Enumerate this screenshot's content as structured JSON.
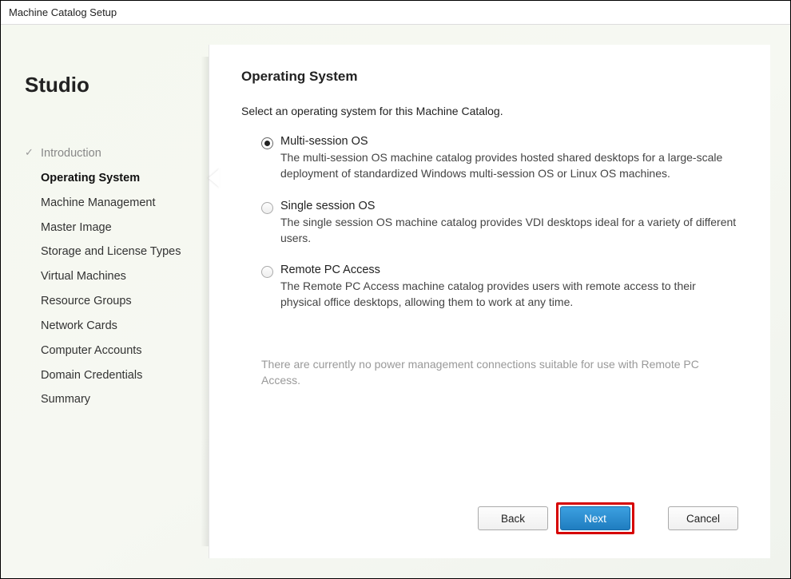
{
  "window": {
    "title": "Machine Catalog Setup"
  },
  "sidebar": {
    "brand": "Studio",
    "items": [
      {
        "label": "Introduction",
        "state": "completed"
      },
      {
        "label": "Operating System",
        "state": "current"
      },
      {
        "label": "Machine Management",
        "state": "pending"
      },
      {
        "label": "Master Image",
        "state": "pending"
      },
      {
        "label": "Storage and License Types",
        "state": "pending"
      },
      {
        "label": "Virtual Machines",
        "state": "pending"
      },
      {
        "label": "Resource Groups",
        "state": "pending"
      },
      {
        "label": "Network Cards",
        "state": "pending"
      },
      {
        "label": "Computer Accounts",
        "state": "pending"
      },
      {
        "label": "Domain Credentials",
        "state": "pending"
      },
      {
        "label": "Summary",
        "state": "pending"
      }
    ]
  },
  "main": {
    "title": "Operating System",
    "instruction": "Select an operating system for this Machine Catalog.",
    "options": [
      {
        "label": "Multi-session OS",
        "description": "The multi-session OS machine catalog provides hosted shared desktops for a large-scale deployment of standardized Windows multi-session OS or Linux OS machines.",
        "selected": true
      },
      {
        "label": "Single session OS",
        "description": "The single session OS machine catalog provides VDI desktops ideal for a variety of different users.",
        "selected": false
      },
      {
        "label": "Remote PC Access",
        "description": "The Remote PC Access machine catalog provides users with remote access to their physical office desktops, allowing them to work at any time.",
        "selected": false
      }
    ],
    "note": "There are currently no power management connections suitable for use with Remote PC Access."
  },
  "buttons": {
    "back": "Back",
    "next": "Next",
    "cancel": "Cancel"
  }
}
